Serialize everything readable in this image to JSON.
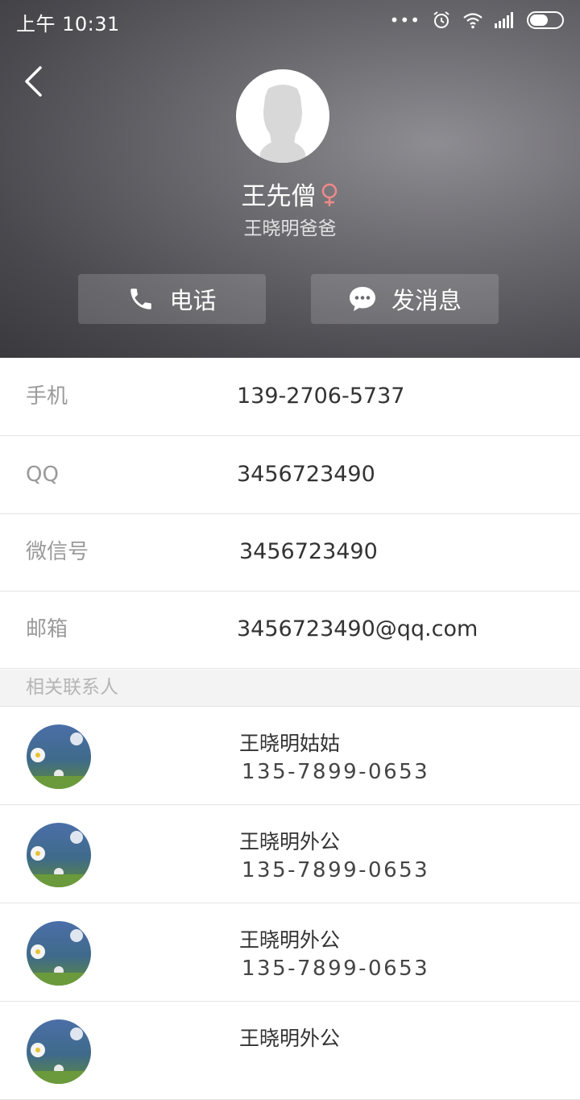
{
  "status_bar": {
    "time": "上午 10:31",
    "icons": [
      "more-dots-icon",
      "alarm-icon",
      "wifi-icon",
      "signal-icon",
      "battery-icon"
    ]
  },
  "header": {
    "back_icon": "chevron-left-icon",
    "name": "王先僧",
    "gender_symbol": "♀",
    "gender_color": "#f08a8a",
    "subtitle": "王晓明爸爸",
    "call_label": "电话",
    "message_label": "发消息"
  },
  "info": [
    {
      "label": "手机",
      "value": "139-2706-5737"
    },
    {
      "label": "QQ",
      "value": "3456723490"
    },
    {
      "label": "微信号",
      "value": "3456723490"
    },
    {
      "label": "邮箱",
      "value": "3456723490@qq.com"
    }
  ],
  "related": {
    "title": "相关联系人",
    "contacts": [
      {
        "name": "王晓明姑姑",
        "phone": "135-7899-0653"
      },
      {
        "name": "王晓明外公",
        "phone": "135-7899-0653"
      },
      {
        "name": "王晓明外公",
        "phone": "135-7899-0653"
      },
      {
        "name": "王晓明外公",
        "phone": ""
      }
    ]
  },
  "colors": {
    "header_gray": "#5a595e",
    "divider": "#e4e4e4",
    "label_gray": "#9a9a9a"
  }
}
